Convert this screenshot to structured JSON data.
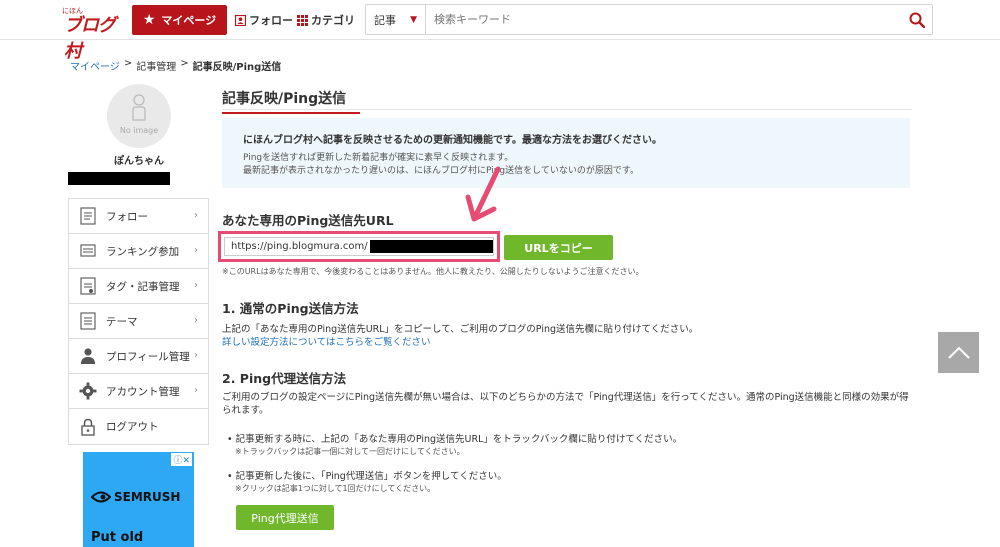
{
  "header": {
    "logo_small": "にほん",
    "logo_main": "ブログ村",
    "mypage_label": "マイページ",
    "follow_label": "フォロー",
    "category_label": "カテゴリ",
    "search_scope": "記事",
    "search_placeholder": "検索キーワード"
  },
  "breadcrumb": {
    "mypage": "マイページ",
    "sep": ">",
    "article_mgmt": "記事管理",
    "current": "記事反映/Ping送信"
  },
  "sidebar": {
    "avatar_text": "No image",
    "username": "ぽんちゃん",
    "items": [
      {
        "label": "フォロー",
        "icon": "reader-icon"
      },
      {
        "label": "ランキング参加",
        "icon": "banner-icon"
      },
      {
        "label": "タグ・記事管理",
        "icon": "post-icon"
      },
      {
        "label": "テーマ",
        "icon": "theme-icon"
      },
      {
        "label": "プロフィール管理",
        "icon": "profile-icon"
      },
      {
        "label": "アカウント管理",
        "icon": "gear-icon"
      },
      {
        "label": "ログアウト",
        "icon": "lock-icon"
      }
    ],
    "ad": {
      "brand": "SEMRUSH",
      "text": "Put old"
    }
  },
  "main": {
    "title": "記事反映/Ping送信",
    "info": {
      "headline": "にほんブログ村へ記事を反映させるための更新通知機能です。最適な方法をお選びください。",
      "line1": "Pingを送信すれば更新した新着記事が確実に素早く反映されます。",
      "line2": "最新記事が表示されなかったり遅いのは、にほんブログ村にPing送信をしていないのが原因です。"
    },
    "url_section": {
      "heading": "あなた専用のPing送信先URL",
      "url_prefix": "https://ping.blogmura.com/",
      "copy_label": "URLをコピー",
      "note": "※このURLはあなた専用で、今後変わることはありません。他人に教えたり、公開したりしないようご注意ください。"
    },
    "section1": {
      "heading": "1. 通常のPing送信方法",
      "text": "上記の「あなた専用のPing送信先URL」をコピーして、ご利用のブログのPing送信先欄に貼り付けてください。",
      "link": "詳しい設定方法についてはこちらをご覧ください"
    },
    "section2": {
      "heading": "2. Ping代理送信方法",
      "text": "ご利用のブログの設定ページにPing送信先欄が無い場合は、以下のどちらかの方法で「Ping代理送信」を行ってください。通常のPing送信機能と同様の効果が得られます。",
      "bullet1": "• 記事更新する時に、上記の「あなた専用のPing送信先URL」をトラックバック欄に貼り付けてください。",
      "bullet1_note": "※トラックバックは記事一個に対して一回だけにしてください。",
      "bullet2": "• 記事更新した後に、「Ping代理送信」ボタンを押してください。",
      "bullet2_note": "※クリックは記事1つに対して1回だけにしてください。",
      "ping_button": "Ping代理送信"
    }
  },
  "colors": {
    "brand_red": "#b8141c",
    "accent_green": "#71b72c",
    "highlight_pink": "#e64b74",
    "link_blue": "#1f6fb7"
  }
}
